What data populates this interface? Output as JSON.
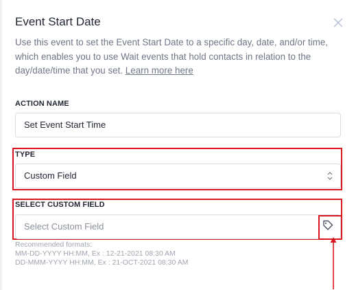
{
  "panel": {
    "title": "Event Start Date",
    "description": "Use this event to set the Event Start Date to a specific day, date, and/or time, which enables you to use Wait events that hold contacts in relation to the day/date/time that you set.",
    "learn_more": "Learn more here"
  },
  "action_name": {
    "label": "ACTION NAME",
    "value": "Set Event Start Time"
  },
  "type": {
    "label": "TYPE",
    "selected": "Custom Field"
  },
  "custom_field": {
    "label": "SELECT CUSTOM FIELD",
    "placeholder": "Select Custom Field"
  },
  "formats": {
    "heading": "Recommended formats:",
    "line1": "MM-DD-YYYY HH:MM, Ex : 12-21-2021 08:30 AM",
    "line2": "DD-MMM-YYYY HH:MM, Ex : 21-OCT-2021 08:30 AM"
  },
  "icons": {
    "close": "close-icon",
    "select_arrows": "chevron-up-down-icon",
    "tag": "tag-icon"
  },
  "colors": {
    "highlight": "#d9161f",
    "border": "#d9dce3",
    "muted_text": "#6e7585"
  }
}
